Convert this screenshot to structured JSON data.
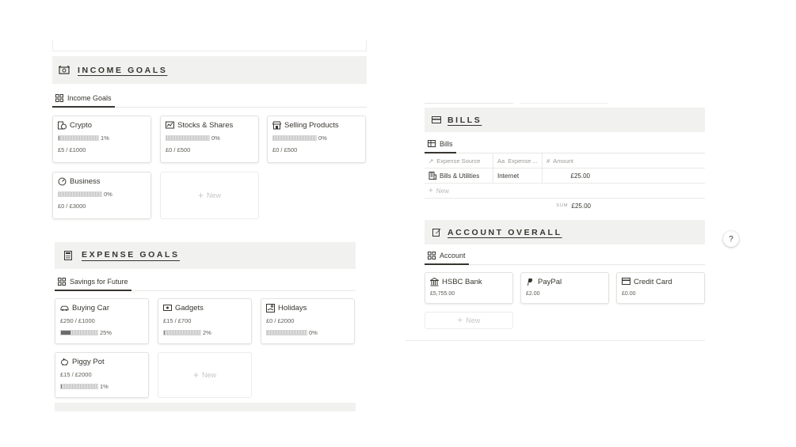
{
  "income_goals": {
    "title": "INCOME GOALS",
    "tab": "Income Goals",
    "cards": [
      {
        "name": "Crypto",
        "icon": "coins-icon",
        "progress_pct": 1,
        "progress_label": "1%",
        "amount": "£5 / £1000"
      },
      {
        "name": "Stocks & Shares",
        "icon": "stock-chart-icon",
        "progress_pct": 0,
        "progress_label": "0%",
        "amount": "£0 / £500"
      },
      {
        "name": "Selling Products",
        "icon": "shop-icon",
        "progress_pct": 0,
        "progress_label": "0%",
        "amount": "£0 / £500"
      },
      {
        "name": "Business",
        "icon": "gauge-icon",
        "progress_pct": 0,
        "progress_label": "0%",
        "amount": "£0 / £3000"
      }
    ],
    "new_label": "New"
  },
  "expense_goals": {
    "title": "EXPENSE GOALS",
    "tab": "Savings for Future",
    "cards": [
      {
        "name": "Buying Car",
        "icon": "car-icon",
        "amount": "£250 / £1000",
        "progress_pct": 25,
        "progress_label": "25%"
      },
      {
        "name": "Gadgets",
        "icon": "gadget-icon",
        "amount": "£15 / £700",
        "progress_pct": 2,
        "progress_label": "2%"
      },
      {
        "name": "Holidays",
        "icon": "beach-icon",
        "amount": "£0 / £2000",
        "progress_pct": 0,
        "progress_label": "0%"
      },
      {
        "name": "Piggy Pot",
        "icon": "piggy-bank-icon",
        "amount": "£15 / £2000",
        "progress_pct": 1,
        "progress_label": "1%"
      }
    ],
    "new_label": "New"
  },
  "bills": {
    "title": "BILLS",
    "tab": "Bills",
    "columns": [
      "Expense Source",
      "Expense ...",
      "Amount"
    ],
    "rows": [
      {
        "source": "Bills & Utilities",
        "expense": "Internet",
        "amount": "£25.00"
      }
    ],
    "new_label": "New",
    "sum_label": "SUM",
    "sum_value": "£25.00"
  },
  "account_overall": {
    "title": "ACCOUNT OVERALL",
    "tab": "Account",
    "cards": [
      {
        "name": "HSBC Bank",
        "icon": "bank-icon",
        "amount": "£5,755.00"
      },
      {
        "name": "PayPal",
        "icon": "paypal-icon",
        "amount": "£2.00"
      },
      {
        "name": "Credit Card",
        "icon": "credit-card-icon",
        "amount": "£0.00"
      }
    ],
    "new_label": "New"
  },
  "help": {
    "label": "?"
  }
}
